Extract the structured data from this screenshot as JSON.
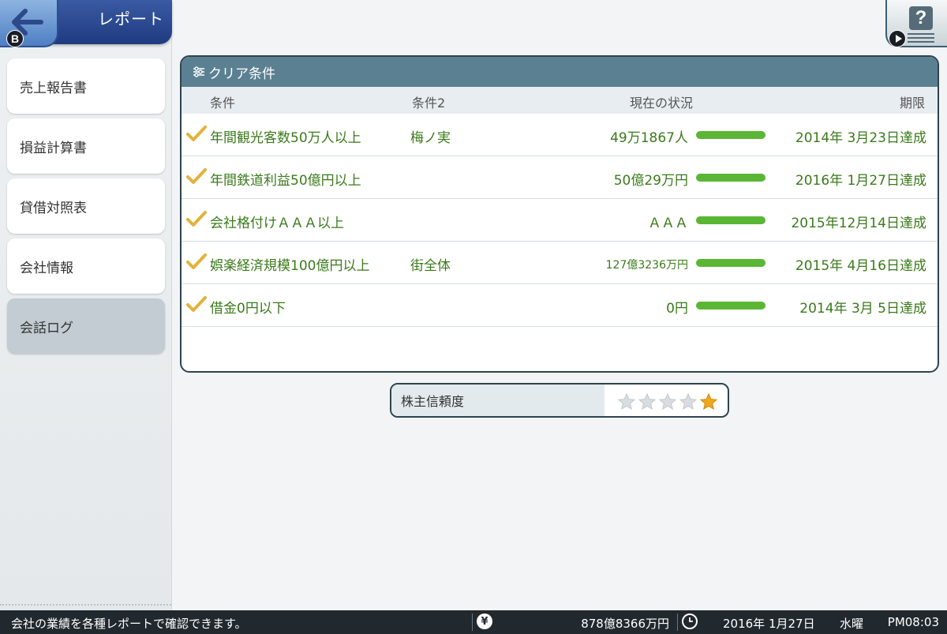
{
  "header": {
    "title": "レポート",
    "back_badge": "B"
  },
  "sidebar": {
    "items": [
      {
        "label": "売上報告書"
      },
      {
        "label": "損益計算書"
      },
      {
        "label": "貸借対照表"
      },
      {
        "label": "会社情報"
      },
      {
        "label": "会話ログ",
        "active": true
      }
    ]
  },
  "help": {
    "icon_glyph": "?"
  },
  "panel": {
    "title": "クリア条件",
    "columns": {
      "condition": "条件",
      "condition2": "条件2",
      "status": "現在の状況",
      "deadline": "期限"
    },
    "rows": [
      {
        "condition": "年間観光客数50万人以上",
        "condition2": "梅ノ実",
        "status": "49万1867人",
        "progress": 1.0,
        "deadline": "2014年 3月23日達成"
      },
      {
        "condition": "年間鉄道利益50億円以上",
        "condition2": "",
        "status": "50億29万円",
        "progress": 1.0,
        "deadline": "2016年 1月27日達成"
      },
      {
        "condition": "会社格付けＡＡＡ以上",
        "condition2": "",
        "status": "ＡＡＡ",
        "progress": 1.0,
        "deadline": "2015年12月14日達成"
      },
      {
        "condition": "娯楽経済規模100億円以上",
        "condition2": "街全体",
        "status": "127億3236万円",
        "progress": 1.0,
        "deadline": "2015年 4月16日達成"
      },
      {
        "condition": "借金0円以下",
        "condition2": "",
        "status": "0円",
        "progress": 1.0,
        "deadline": "2014年 3月 5日達成"
      }
    ]
  },
  "shareholder_trust": {
    "label": "株主信頼度",
    "stars_filled": 1,
    "stars_total": 5
  },
  "status_bar": {
    "message": "会社の業績を各種レポートで確認できます。",
    "yen_icon": "¥",
    "funds": "878億8366万円",
    "date": "2016年 1月27日",
    "weekday": "水曜",
    "time": "PM08:03"
  },
  "colors": {
    "accent": "#5b8091",
    "progress": "#5bb635",
    "text_green": "#3a7a1a",
    "star": "#f0a81c"
  }
}
